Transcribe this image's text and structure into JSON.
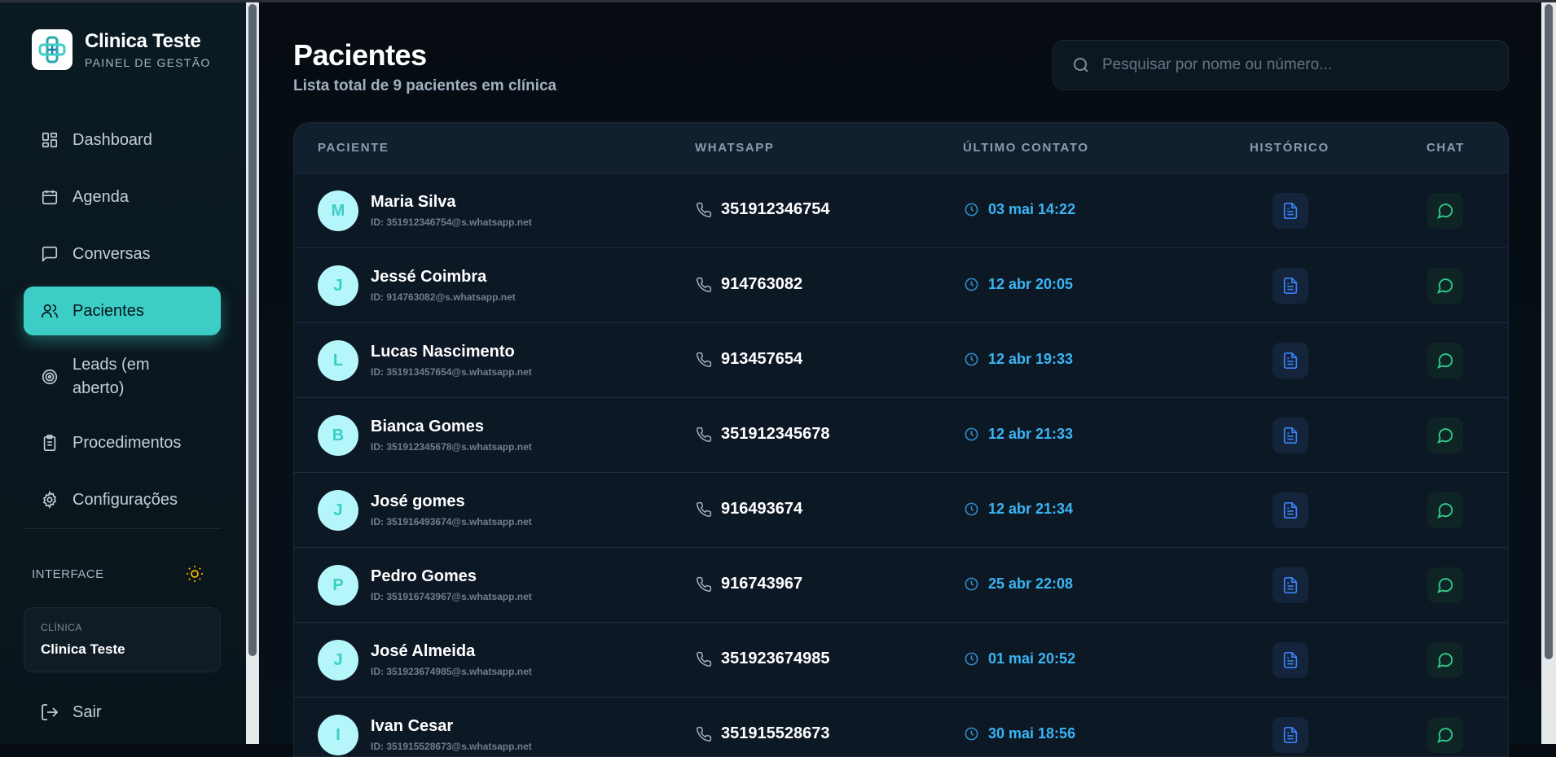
{
  "brand": {
    "name": "Clinica Teste",
    "subtitle": "PAINEL DE GESTÃO"
  },
  "sidebar": {
    "items": [
      {
        "label": "Dashboard",
        "icon": "dashboard-icon"
      },
      {
        "label": "Agenda",
        "icon": "calendar-icon"
      },
      {
        "label": "Conversas",
        "icon": "message-square-icon"
      },
      {
        "label": "Pacientes",
        "icon": "users-icon",
        "active": true
      },
      {
        "label": "Leads (em aberto)",
        "icon": "target-icon"
      },
      {
        "label": "Procedimentos",
        "icon": "clipboard-icon"
      },
      {
        "label": "Configurações",
        "icon": "gear-icon"
      }
    ],
    "interface_label": "INTERFACE",
    "clinic_caption": "CLÍNICA",
    "clinic_name": "Clinica Teste",
    "logout_label": "Sair"
  },
  "page": {
    "title": "Pacientes",
    "subtitle": "Lista total de 9 pacientes em clínica"
  },
  "search": {
    "placeholder": "Pesquisar por nome ou número..."
  },
  "table": {
    "headers": {
      "patient": "PACIENTE",
      "whatsapp": "WHATSAPP",
      "last_contact": "ÚLTIMO CONTATO",
      "history": "HISTÓRICO",
      "chat": "CHAT"
    },
    "rows": [
      {
        "initial": "M",
        "name": "Maria Silva",
        "id": "ID: 351912346754@s.whatsapp.net",
        "phone": "351912346754",
        "last": "03 mai 14:22"
      },
      {
        "initial": "J",
        "name": "Jessé Coimbra",
        "id": "ID: 914763082@s.whatsapp.net",
        "phone": "914763082",
        "last": "12 abr 20:05"
      },
      {
        "initial": "L",
        "name": "Lucas Nascimento",
        "id": "ID: 351913457654@s.whatsapp.net",
        "phone": "913457654",
        "last": "12 abr 19:33"
      },
      {
        "initial": "B",
        "name": "Bianca Gomes",
        "id": "ID: 351912345678@s.whatsapp.net",
        "phone": "351912345678",
        "last": "12 abr 21:33"
      },
      {
        "initial": "J",
        "name": "José gomes",
        "id": "ID: 351916493674@s.whatsapp.net",
        "phone": "916493674",
        "last": "12 abr 21:34"
      },
      {
        "initial": "P",
        "name": "Pedro Gomes",
        "id": "ID: 351916743967@s.whatsapp.net",
        "phone": "916743967",
        "last": "25 abr 22:08"
      },
      {
        "initial": "J",
        "name": "José Almeida",
        "id": "ID: 351923674985@s.whatsapp.net",
        "phone": "351923674985",
        "last": "01 mai 20:52"
      },
      {
        "initial": "I",
        "name": "Ivan Cesar",
        "id": "ID: 351915528673@s.whatsapp.net",
        "phone": "351915528673",
        "last": "30 mai 18:56"
      }
    ]
  },
  "colors": {
    "accent": "#3ccdc6",
    "date": "#3bb4f2",
    "chat": "#2fd08a",
    "history": "#3b82f6",
    "sun": "#f5b400"
  }
}
